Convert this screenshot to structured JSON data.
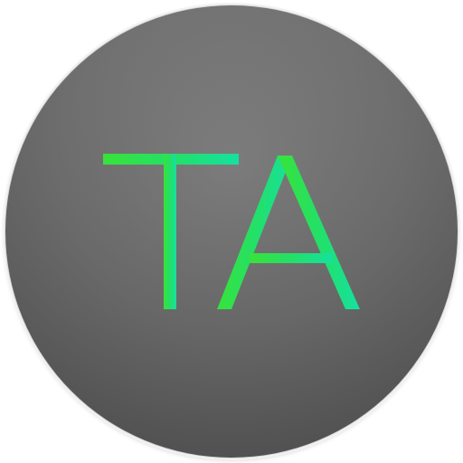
{
  "app_icon": {
    "monogram": {
      "text": "TA",
      "letters": [
        "T",
        "A"
      ]
    },
    "colors": {
      "badge_light": "#7a7a7a",
      "badge_dark": "#4f4f4f",
      "monogram_green": "#38e23a",
      "monogram_teal": "#16e0a0"
    }
  }
}
